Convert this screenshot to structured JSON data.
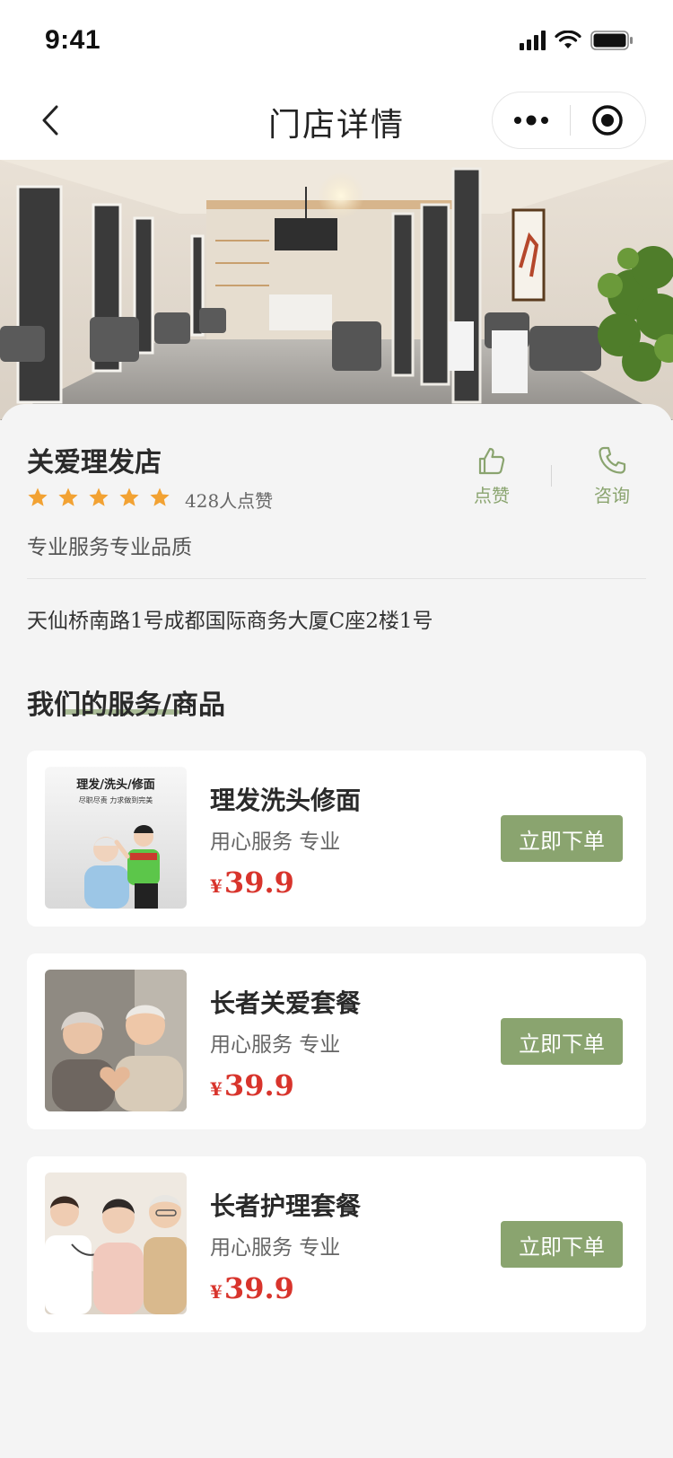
{
  "status_bar": {
    "time": "9:41"
  },
  "nav": {
    "title": "门店详情"
  },
  "store": {
    "name": "关爱理发店",
    "rating_stars": 5,
    "likes_text": "428人点赞",
    "slogan": "专业服务专业品质",
    "address": "天仙桥南路1号成都国际商务大厦C座2楼1号",
    "actions": {
      "like_label": "点赞",
      "consult_label": "咨询"
    }
  },
  "section": {
    "title": "我们的服务/商品"
  },
  "thumb_texts": {
    "banner_title": "理发/洗头/修面",
    "banner_sub": "尽职尽责 力求做到完美"
  },
  "services": [
    {
      "title": "理发洗头修面",
      "desc": "用心服务 专业",
      "currency": "¥",
      "price": "39.9",
      "button": "立即下单"
    },
    {
      "title": "长者关爱套餐",
      "desc": "用心服务 专业",
      "currency": "¥",
      "price": "39.9",
      "button": "立即下单"
    },
    {
      "title": "长者护理套餐",
      "desc": "用心服务 专业",
      "currency": "¥",
      "price": "39.9",
      "button": "立即下单"
    }
  ],
  "colors": {
    "accent": "#8aa46f",
    "price": "#d8342c",
    "star": "#f2a233"
  }
}
